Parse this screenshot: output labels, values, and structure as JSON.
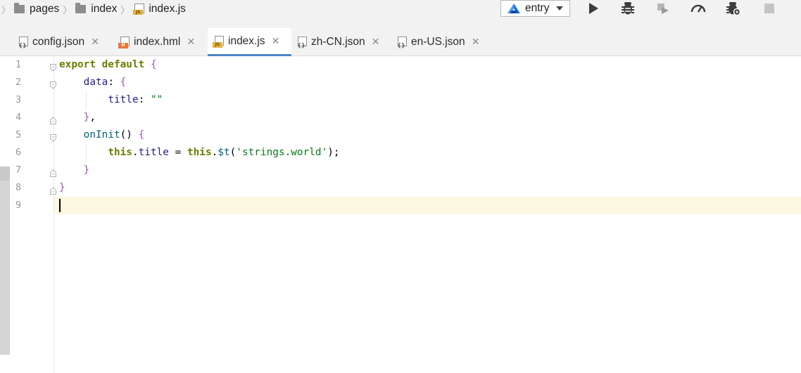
{
  "breadcrumb": {
    "items": [
      {
        "label": "pages",
        "icon": "folder-icon"
      },
      {
        "label": "index",
        "icon": "folder-icon"
      },
      {
        "label": "index.js",
        "icon": "js-file-icon"
      }
    ]
  },
  "toolbar": {
    "run_config": "entry",
    "buttons": [
      "run-icon",
      "debug-icon",
      "attach-debugger-icon",
      "profiler-icon",
      "debug-settings-icon",
      "stop-icon"
    ]
  },
  "tabs": [
    {
      "label": "config.json",
      "icon": "json-file-icon",
      "active": false
    },
    {
      "label": "index.hml",
      "icon": "hml-file-icon",
      "active": false
    },
    {
      "label": "index.js",
      "icon": "js-file-icon",
      "active": true
    },
    {
      "label": "zh-CN.json",
      "icon": "json-file-icon",
      "active": false
    },
    {
      "label": "en-US.json",
      "icon": "json-file-icon",
      "active": false
    }
  ],
  "editor": {
    "line_numbers": [
      "1",
      "2",
      "3",
      "4",
      "5",
      "6",
      "7",
      "8",
      "9"
    ],
    "lines": [
      "export default {",
      "    data: {",
      "        title: \"\"",
      "    },",
      "    onInit() {",
      "        this.title = this.$t('strings.world');",
      "    }",
      "}",
      ""
    ],
    "current_line": 9
  },
  "colors": {
    "keyword": "#000080",
    "accent": "#4a88c7",
    "current_line_bg": "#fdf8e1",
    "brace": "#a452b6",
    "string": "#067d17"
  }
}
